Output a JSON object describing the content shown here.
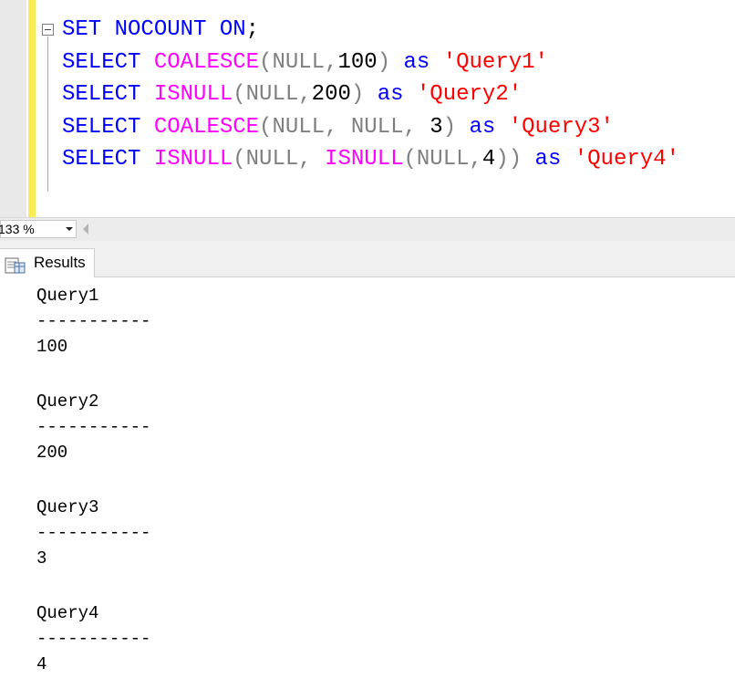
{
  "editor": {
    "lines": [
      [
        {
          "t": "SET NOCOUNT ON",
          "c": "kw"
        },
        {
          "t": ";",
          "c": "pl"
        }
      ],
      [
        {
          "t": "SELECT ",
          "c": "kw"
        },
        {
          "t": "COALESCE",
          "c": "fn"
        },
        {
          "t": "(",
          "c": "gr"
        },
        {
          "t": "NULL",
          "c": "gr"
        },
        {
          "t": ",",
          "c": "gr"
        },
        {
          "t": "100",
          "c": "pl"
        },
        {
          "t": ")",
          "c": "gr"
        },
        {
          "t": " as ",
          "c": "kw"
        },
        {
          "t": "'Query1'",
          "c": "st"
        }
      ],
      [
        {
          "t": "SELECT ",
          "c": "kw"
        },
        {
          "t": "ISNULL",
          "c": "fn"
        },
        {
          "t": "(",
          "c": "gr"
        },
        {
          "t": "NULL",
          "c": "gr"
        },
        {
          "t": ",",
          "c": "gr"
        },
        {
          "t": "200",
          "c": "pl"
        },
        {
          "t": ")",
          "c": "gr"
        },
        {
          "t": " as ",
          "c": "kw"
        },
        {
          "t": "'Query2'",
          "c": "st"
        }
      ],
      [
        {
          "t": "SELECT ",
          "c": "kw"
        },
        {
          "t": "COALESCE",
          "c": "fn"
        },
        {
          "t": "(",
          "c": "gr"
        },
        {
          "t": "NULL",
          "c": "gr"
        },
        {
          "t": ", ",
          "c": "gr"
        },
        {
          "t": "NULL",
          "c": "gr"
        },
        {
          "t": ", ",
          "c": "gr"
        },
        {
          "t": "3",
          "c": "pl"
        },
        {
          "t": ")",
          "c": "gr"
        },
        {
          "t": " as ",
          "c": "kw"
        },
        {
          "t": "'Query3'",
          "c": "st"
        }
      ],
      [
        {
          "t": "SELECT ",
          "c": "kw"
        },
        {
          "t": "ISNULL",
          "c": "fn"
        },
        {
          "t": "(",
          "c": "gr"
        },
        {
          "t": "NULL",
          "c": "gr"
        },
        {
          "t": ", ",
          "c": "gr"
        },
        {
          "t": "ISNULL",
          "c": "fn"
        },
        {
          "t": "(",
          "c": "gr"
        },
        {
          "t": "NULL",
          "c": "gr"
        },
        {
          "t": ",",
          "c": "gr"
        },
        {
          "t": "4",
          "c": "pl"
        },
        {
          "t": "))",
          "c": "gr"
        },
        {
          "t": " as ",
          "c": "kw"
        },
        {
          "t": "'Query4'",
          "c": "st"
        }
      ]
    ]
  },
  "zoom": {
    "value": "133 %"
  },
  "tabs": {
    "results_label": "Results"
  },
  "results": [
    {
      "column": "Query1",
      "separator": "-----------",
      "value": "100"
    },
    {
      "column": "Query2",
      "separator": "-----------",
      "value": "200"
    },
    {
      "column": "Query3",
      "separator": "-----------",
      "value": "3"
    },
    {
      "column": "Query4",
      "separator": "-----------",
      "value": "4"
    }
  ],
  "colors": {
    "keyword": "#0000ff",
    "function": "#ff00ff",
    "grey": "#808080",
    "string": "#ff0000",
    "change_bar": "#f6ed57"
  }
}
